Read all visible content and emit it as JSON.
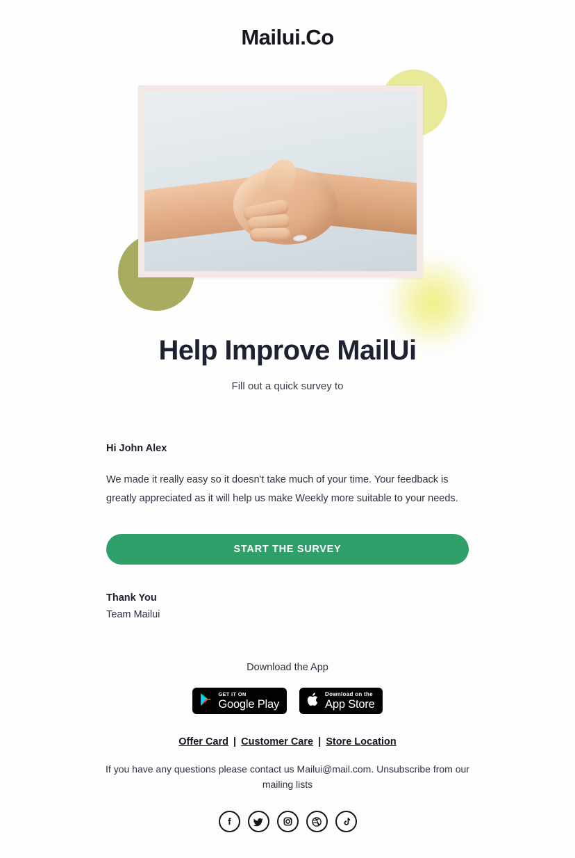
{
  "brand": {
    "logo_text": "Mailui.Co",
    "accent_green": "#2fa069",
    "deco_yellow": "#e9e99a",
    "deco_olive": "#a9ac60",
    "text_dark": "#1e2130",
    "background": "#fdfdfd"
  },
  "hero": {
    "image_alt": "handshake-photo"
  },
  "headline": "Help Improve MailUi",
  "subhead": "Fill out a quick survey to",
  "body": {
    "greeting": "Hi John Alex",
    "paragraph": "We made it really easy so it doesn't take much of your time. Your feedback is greatly appreciated as it will help us make Weekly more suitable to your needs."
  },
  "cta": {
    "label": "START THE SURVEY"
  },
  "signoff": {
    "title": "Thank You",
    "team": "Team Mailui"
  },
  "footer": {
    "download_label": "Download the App",
    "badges": [
      {
        "small": "GET IT ON",
        "big": "Google Play",
        "icon": "google-play-icon"
      },
      {
        "small": "Download on the",
        "big": "App Store",
        "icon": "apple-icon"
      }
    ],
    "links": [
      {
        "label": "Offer Card"
      },
      {
        "label": "Customer Care"
      },
      {
        "label": "Store Location"
      }
    ],
    "link_separator": "|",
    "contact_text": "If you have any questions please contact us Mailui@mail.com. Unsubscribe from our mailing lists",
    "socials": [
      {
        "name": "facebook-icon"
      },
      {
        "name": "twitter-icon"
      },
      {
        "name": "instagram-icon"
      },
      {
        "name": "dribbble-icon"
      },
      {
        "name": "tiktok-icon"
      }
    ]
  }
}
